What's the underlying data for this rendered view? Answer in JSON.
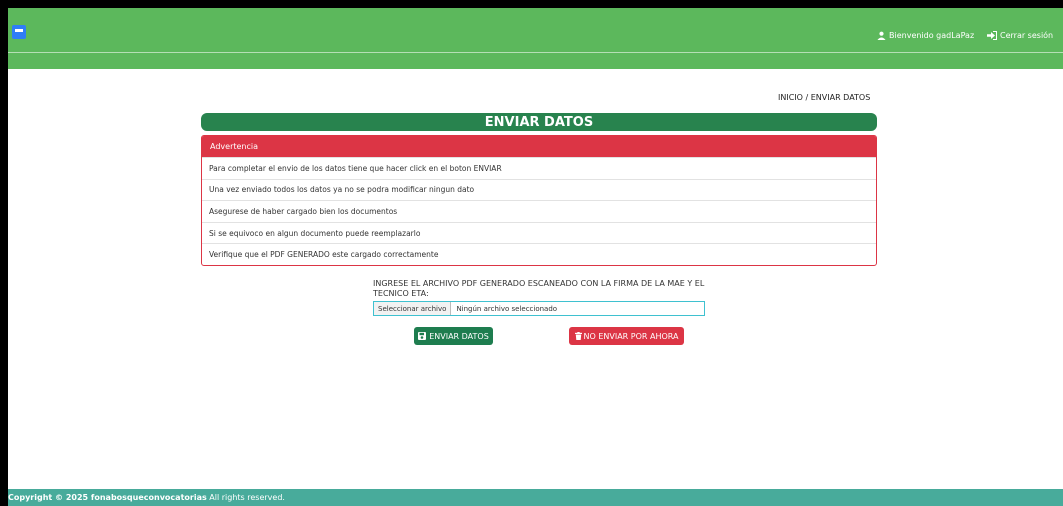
{
  "header": {
    "menu_icon": "menu-icon",
    "user_label": "Bienvenido gadLaPaz",
    "user_icon": "user-icon",
    "logout_label": "Cerrar sesión",
    "logout_icon": "sign-out-icon"
  },
  "breadcrumb": "INICIO / ENVIAR DATOS",
  "main": {
    "title": "ENVIAR DATOS",
    "alert": {
      "header": "Advertencia",
      "items": [
        "Para completar el envio de los datos tiene que hacer click en el boton ENVIAR",
        "Una vez enviado todos los datos ya no se podra modificar ningun dato",
        "Asegurese de haber cargado bien los documentos",
        "Si se equivoco en algun documento puede reemplazarlo",
        "Verifique que el PDF GENERADO este cargado correctamente"
      ]
    },
    "upload_label": "INGRESE EL ARCHIVO PDF GENERADO ESCANEADO CON LA FIRMA DE LA MAE Y EL TECNICO ETA:",
    "file_button": "Seleccionar archivo",
    "file_status": "Ningún archivo seleccionado",
    "send_button": "ENVIAR DATOS",
    "send_icon": "save-icon",
    "no_send_button": "NO ENVIAR POR AHORA",
    "no_send_icon": "trash-icon"
  },
  "footer": {
    "copyright": "Copyright © 2025",
    "brand": "fonabosqueconvocatorias",
    "rights": "All rights reserved."
  },
  "colors": {
    "topbar": "#5cb85c",
    "title_bar": "#28834e",
    "alert": "#dc3545",
    "footer": "#48ab9b",
    "menu_button": "#2f7df6"
  }
}
